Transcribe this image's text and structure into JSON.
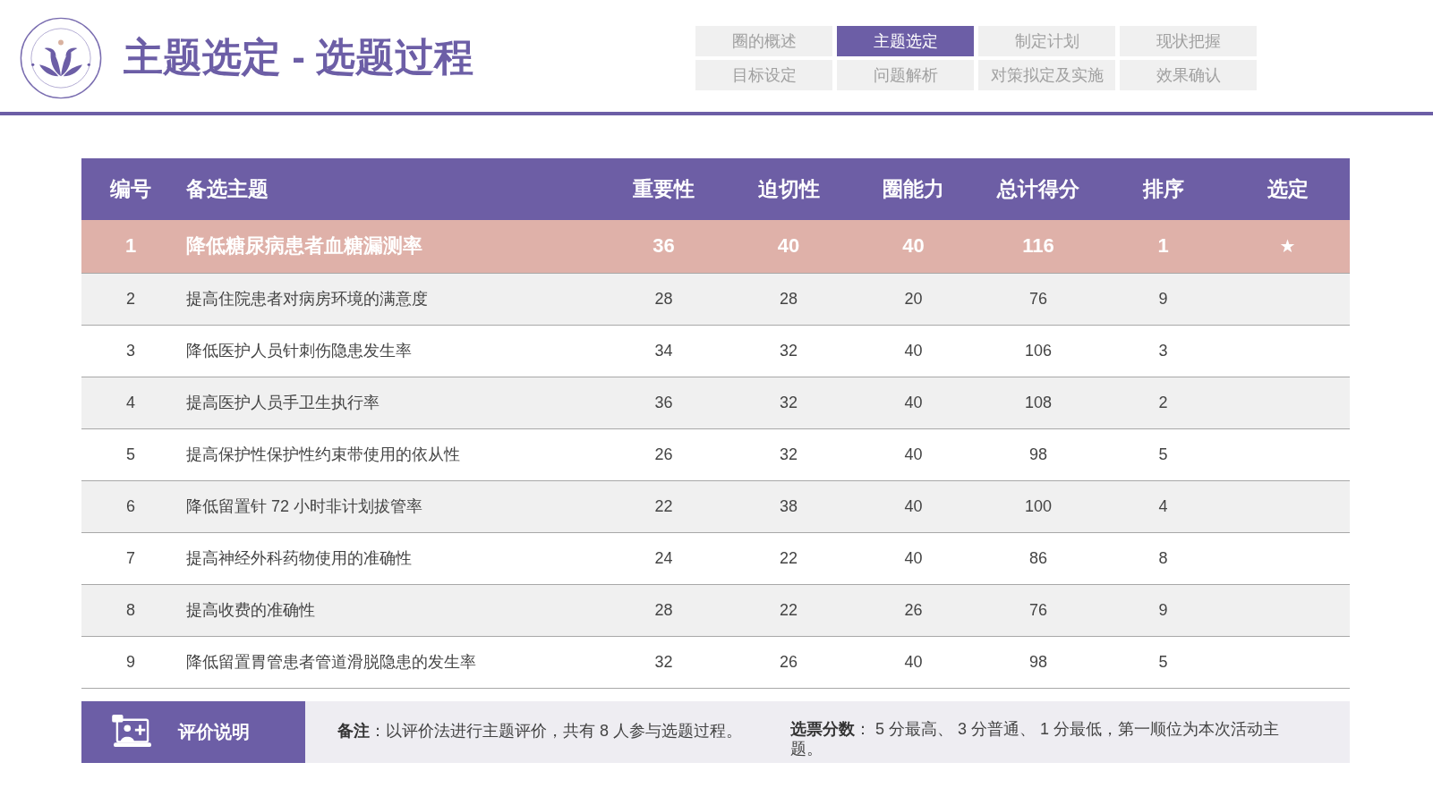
{
  "header": {
    "title": "主题选定 - 选题过程"
  },
  "nav": {
    "tabs": [
      {
        "label": "圈的概述",
        "selected": false
      },
      {
        "label": "主题选定",
        "selected": true
      },
      {
        "label": "制定计划",
        "selected": false
      },
      {
        "label": "现状把握",
        "selected": false
      },
      {
        "label": "目标设定",
        "selected": false
      },
      {
        "label": "问题解析",
        "selected": false
      },
      {
        "label": "对策拟定及实施",
        "selected": false
      },
      {
        "label": "效果确认",
        "selected": false
      }
    ]
  },
  "table": {
    "columns": [
      "编号",
      "备选主题",
      "重要性",
      "迫切性",
      "圈能力",
      "总计得分",
      "排序",
      "选定"
    ],
    "rows": [
      {
        "cells": [
          "1",
          "降低糖尿病患者血糖漏测率",
          "36",
          "40",
          "40",
          "116",
          "1"
        ],
        "mark": "★",
        "selected": true
      },
      {
        "cells": [
          "2",
          "提高住院患者对病房环境的满意度",
          "28",
          "28",
          "20",
          "76",
          "9"
        ],
        "selected": false
      },
      {
        "cells": [
          "3",
          "降低医护人员针刺伤隐患发生率",
          "34",
          "32",
          "40",
          "106",
          "3"
        ],
        "selected": false
      },
      {
        "cells": [
          "4",
          "提高医护人员手卫生执行率",
          "36",
          "32",
          "40",
          "108",
          "2"
        ],
        "selected": false
      },
      {
        "cells": [
          "5",
          "提高保护性保护性约束带使用的依从性",
          "26",
          "32",
          "40",
          "98",
          "5"
        ],
        "selected": false
      },
      {
        "cells": [
          "6",
          "降低留置针 72 小时非计划拔管率",
          "22",
          "38",
          "40",
          "100",
          "4"
        ],
        "selected": false
      },
      {
        "cells": [
          "7",
          "提高神经外科药物使用的准确性",
          "24",
          "22",
          "40",
          "86",
          "8"
        ],
        "selected": false
      },
      {
        "cells": [
          "8",
          "提高收费的准确性",
          "28",
          "22",
          "26",
          "76",
          "9"
        ],
        "selected": false
      },
      {
        "cells": [
          "9",
          "降低留置胃管患者管道滑脱隐患的发生率",
          "32",
          "26",
          "40",
          "98",
          "5"
        ],
        "selected": false
      }
    ]
  },
  "footer": {
    "label": "评价说明",
    "notes": [
      "**备注**：以评价法进行主题评价，共有 8 人参与选题过程。",
      "**选票分数**： 5 分最高、 3 分普通、 1 分最低，第一顺位为本次活动主题。"
    ]
  }
}
